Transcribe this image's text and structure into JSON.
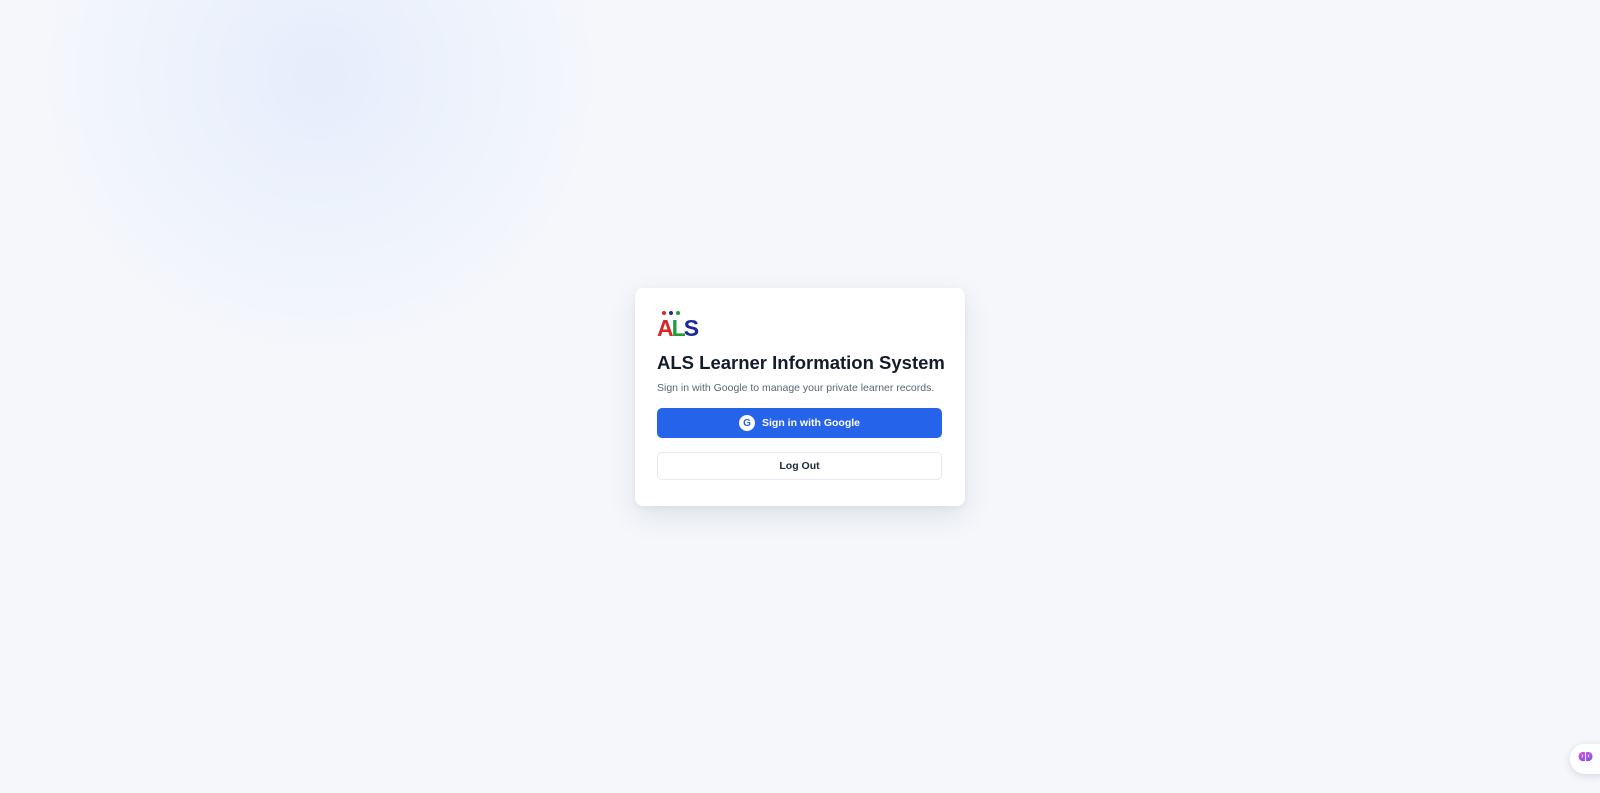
{
  "brand": {
    "logo_letters": [
      "A",
      "L",
      "S"
    ],
    "logo_letter_colors": [
      "#d62828",
      "#1e9e3a",
      "#1a2a9c"
    ],
    "logo_dot_colors": [
      "#d62828",
      "#1a2a9c",
      "#1e9e3a"
    ]
  },
  "login": {
    "title": "ALS Learner Information System",
    "subtitle": "Sign in with Google to manage your private learner records.",
    "google_button_label": "Sign in with Google",
    "google_icon_glyph": "G",
    "logout_button_label": "Log Out"
  },
  "colors": {
    "primary": "#2563eb",
    "background": "#f5f7fb",
    "card": "#ffffff"
  },
  "icons": {
    "google": "google-icon",
    "floating_assistant": "brain-icon"
  }
}
